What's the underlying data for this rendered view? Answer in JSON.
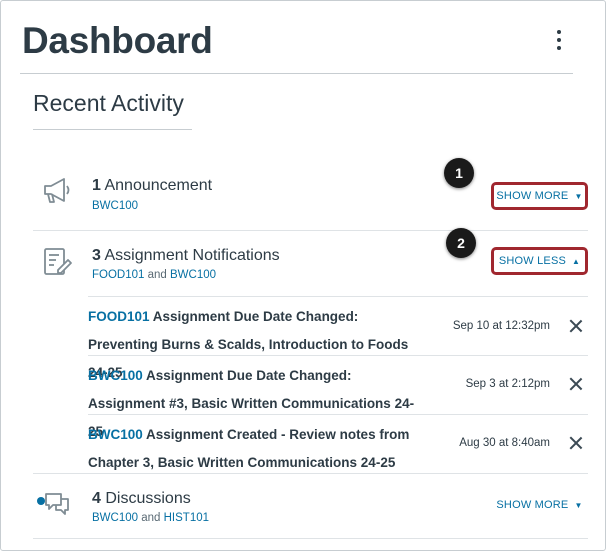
{
  "header": {
    "title": "Dashboard",
    "menu_icon": "kebab-menu-icon"
  },
  "recent_activity": {
    "title": "Recent Activity",
    "groups": [
      {
        "count": "1",
        "label": "Announcement",
        "icon": "megaphone-icon",
        "courses": [
          "BWC100"
        ],
        "toggle_label": "SHOW MORE",
        "toggle_caret": "▼",
        "callout": "1"
      },
      {
        "count": "3",
        "label": "Assignment Notifications",
        "icon": "assignment-icon",
        "courses": [
          "FOOD101",
          "BWC100"
        ],
        "joiner": "and",
        "toggle_label": "SHOW LESS",
        "toggle_caret": "▲",
        "callout": "2",
        "items": [
          {
            "course": "FOOD101",
            "text": " Assignment Due Date Changed: Preventing Burns & Scalds, Introduction to Foods 24-25",
            "date": "Sep 10 at 12:32pm"
          },
          {
            "course": "BWC100",
            "text": " Assignment Due Date Changed: Assignment #3, Basic Written Communications 24-25",
            "date": "Sep 3 at 2:12pm"
          },
          {
            "course": "BWC100",
            "text": " Assignment Created - Review notes from Chapter 3, Basic Written Communications 24-25",
            "date": "Aug 30 at 8:40am"
          }
        ]
      },
      {
        "count": "4",
        "label": "Discussions",
        "icon": "discussion-icon",
        "courses": [
          "BWC100",
          "HIST101"
        ],
        "joiner": "and",
        "toggle_label": "SHOW MORE",
        "toggle_caret": "▼"
      }
    ]
  },
  "colors": {
    "link": "#0770a3",
    "text": "#2d3b45",
    "highlight": "#a0272f",
    "unread_dot": "#0770a3"
  }
}
